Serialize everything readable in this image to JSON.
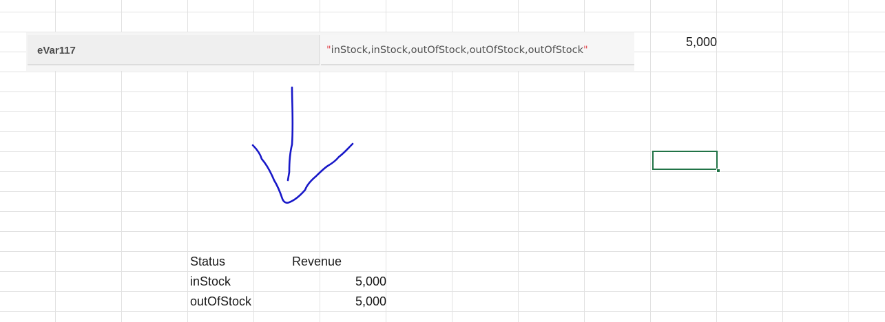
{
  "pasted_image": {
    "variable_name": "eVar117",
    "value_open_quote": "\"",
    "value_text": "inStock,inStock,outOfStock,outOfStock,outOfStock",
    "value_close_quote": "\""
  },
  "cells": {
    "top_right_value": "5,000"
  },
  "summary_table": {
    "headers": [
      "Status",
      "Revenue"
    ],
    "rows": [
      {
        "status": "inStock",
        "revenue": "5,000"
      },
      {
        "status": "outOfStock",
        "revenue": "5,000"
      }
    ]
  },
  "colors": {
    "arrow_ink": "#1818c8",
    "selection": "#217346",
    "gridline": "#e1e1e1"
  }
}
